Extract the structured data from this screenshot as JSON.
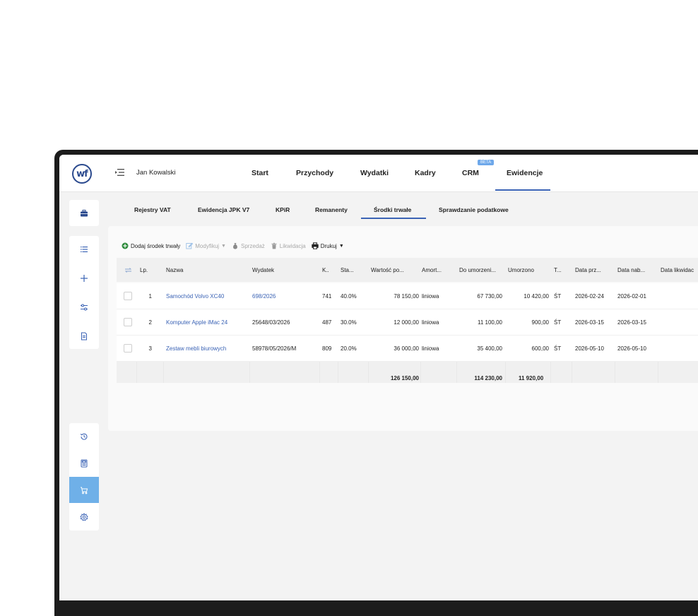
{
  "header": {
    "user_name": "Jan Kowalski",
    "nav": [
      "Start",
      "Przychody",
      "Wydatki",
      "Kadry",
      "CRM",
      "Ewidencje"
    ],
    "beta_badge": "BETA",
    "active_nav": "Ewidencje",
    "accent": "#3b63b5"
  },
  "subnav": {
    "items": [
      "Rejestry VAT",
      "Ewidencja JPK V7",
      "KPiR",
      "Remanenty",
      "Środki trwałe",
      "Sprawdzanie podatkowe"
    ],
    "active": "Środki trwałe"
  },
  "toolbar": {
    "add_label": "Dodaj środek trwały",
    "modify_label": "Modyfikuj",
    "sale_label": "Sprzedaż",
    "liquidation_label": "Likwidacja",
    "print_label": "Drukuj"
  },
  "table": {
    "columns": [
      "Lp.",
      "Nazwa",
      "Wydatek",
      "K..",
      "Sta...",
      "Wartość po...",
      "Amort...",
      "Do umorzeni...",
      "Umorzono",
      "T...",
      "Data prz...",
      "Data nab...",
      "Data likwidac"
    ],
    "rows": [
      {
        "lp": "1",
        "nazwa": "Samochód Volvo XC40",
        "wydatek": "698/2026",
        "k": "741",
        "stawka": "40.0%",
        "wartosc": "78 150,00",
        "amort": "liniowa",
        "do_umorzenia": "67 730,00",
        "umorzono": "10 420,00",
        "typ": "ŚT",
        "data_przyjecia": "2026-02-24",
        "data_nabycia": "2026-02-01",
        "data_likwidacji": ""
      },
      {
        "lp": "2",
        "nazwa": "Komputer Apple iMac 24",
        "wydatek": "25648/03/2026",
        "k": "487",
        "stawka": "30.0%",
        "wartosc": "12 000,00",
        "amort": "liniowa",
        "do_umorzenia": "11 100,00",
        "umorzono": "900,00",
        "typ": "ŚT",
        "data_przyjecia": "2026-03-15",
        "data_nabycia": "2026-03-15",
        "data_likwidacji": ""
      },
      {
        "lp": "3",
        "nazwa": "Zestaw mebli biurowych",
        "wydatek": "58978/05/2026/M",
        "k": "809",
        "stawka": "20.0%",
        "wartosc": "36 000,00",
        "amort": "liniowa",
        "do_umorzenia": "35 400,00",
        "umorzono": "600,00",
        "typ": "ŚT",
        "data_przyjecia": "2026-05-10",
        "data_nabycia": "2026-05-10",
        "data_likwidacji": ""
      }
    ],
    "totals": {
      "wartosc": "126 150,00",
      "do_umorzenia": "114 230,00",
      "umorzono": "11 920,00"
    }
  },
  "sidebar": {
    "top_icons": [
      "briefcase-icon",
      "list-icon",
      "plus-icon",
      "sliders-icon",
      "document-icon"
    ],
    "bottom_icons": [
      "history-icon",
      "calculator-icon",
      "cart-icon",
      "gear-icon"
    ],
    "active_icon": "cart-icon",
    "active_color": "#6fb0e8"
  },
  "logo_text": "wf"
}
